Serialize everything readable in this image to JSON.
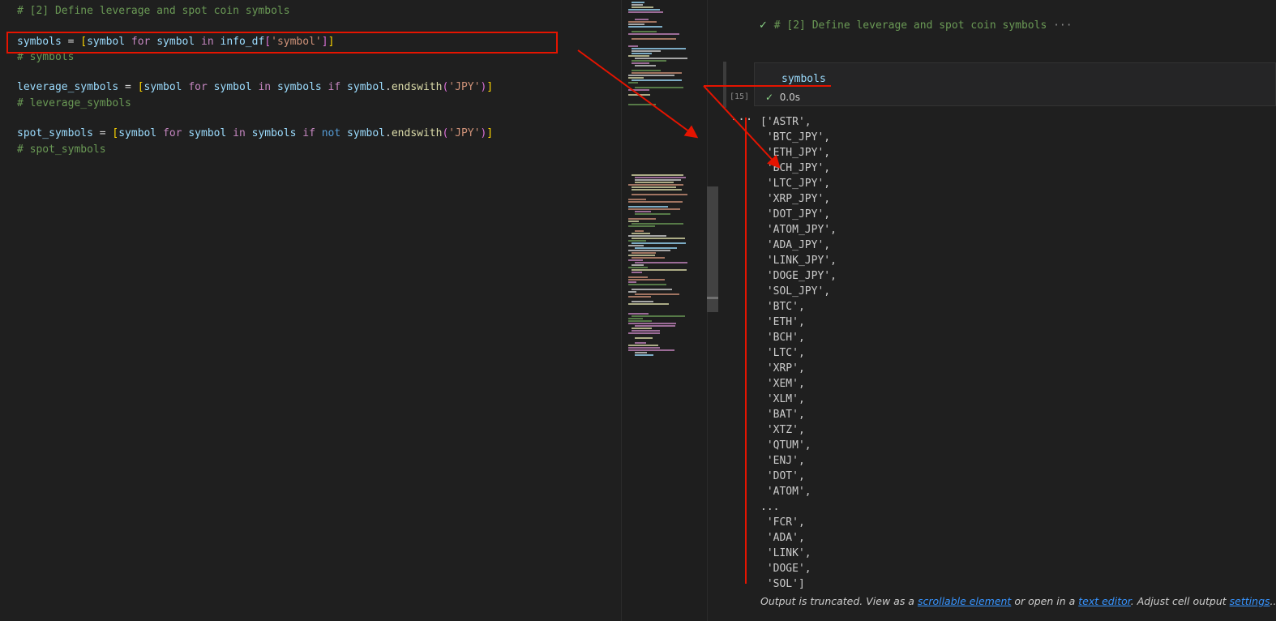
{
  "editor": {
    "line1_comment": "# [2] Define leverage and spot coin symbols",
    "line3": {
      "var": "symbols",
      "op": " = ",
      "lb": "[",
      "a": "symbol",
      "kw_for": " for ",
      "b": "symbol",
      "kw_in": " in ",
      "obj": "info_df",
      "lb2": "[",
      "key": "'symbol'",
      "rb2": "]",
      "rb": "]"
    },
    "line4_comment": "# symbols",
    "line6": {
      "var": "leverage_symbols",
      "op": " = ",
      "lb": "[",
      "a": "symbol",
      "kw_for": " for ",
      "b": "symbol",
      "kw_in": " in ",
      "c": "symbols",
      "kw_if": " if ",
      "d": "symbol",
      "dot": ".",
      "method": "endswith",
      "lp": "(",
      "arg": "'JPY'",
      "rp": ")",
      "rb": "]"
    },
    "line7_comment": "# leverage_symbols",
    "line9": {
      "var": "spot_symbols",
      "op": " = ",
      "lb": "[",
      "a": "symbol",
      "kw_for": " for ",
      "b": "symbol",
      "kw_in": " in ",
      "c": "symbols",
      "kw_if": " if ",
      "kw_not": "not ",
      "d": "symbol",
      "dot": ".",
      "method": "endswith",
      "lp": "(",
      "arg": "'JPY'",
      "rp": ")",
      "rb": "]"
    },
    "line10_comment": "# spot_symbols"
  },
  "notebook": {
    "markdown_title": "# [2] Define leverage and spot coin symbols",
    "markdown_more": "···",
    "cell_source": "symbols",
    "exec_count": "[15]",
    "exec_time": "0.0s",
    "output_more": "···",
    "output_lines": [
      "['ASTR',",
      " 'BTC_JPY',",
      " 'ETH_JPY',",
      " 'BCH_JPY',",
      " 'LTC_JPY',",
      " 'XRP_JPY',",
      " 'DOT_JPY',",
      " 'ATOM_JPY',",
      " 'ADA_JPY',",
      " 'LINK_JPY',",
      " 'DOGE_JPY',",
      " 'SOL_JPY',",
      " 'BTC',",
      " 'ETH',",
      " 'BCH',",
      " 'LTC',",
      " 'XRP',",
      " 'XEM',",
      " 'XLM',",
      " 'BAT',",
      " 'XTZ',",
      " 'QTUM',",
      " 'ENJ',",
      " 'DOT',",
      " 'ATOM',",
      "...",
      " 'FCR',",
      " 'ADA',",
      " 'LINK',",
      " 'DOGE',",
      " 'SOL']"
    ],
    "truncated": {
      "prefix": "Output is truncated. View as a ",
      "link1": "scrollable element",
      "mid1": " or open in a ",
      "link2": "text editor",
      "mid2": ". Adjust cell output ",
      "link3": "settings",
      "suffix": "..."
    }
  },
  "icons": {
    "check": "check-icon",
    "ellipsis": "more-icon"
  },
  "colors": {
    "annotation": "#e51400",
    "check": "#89d185",
    "link": "#3794ff"
  }
}
